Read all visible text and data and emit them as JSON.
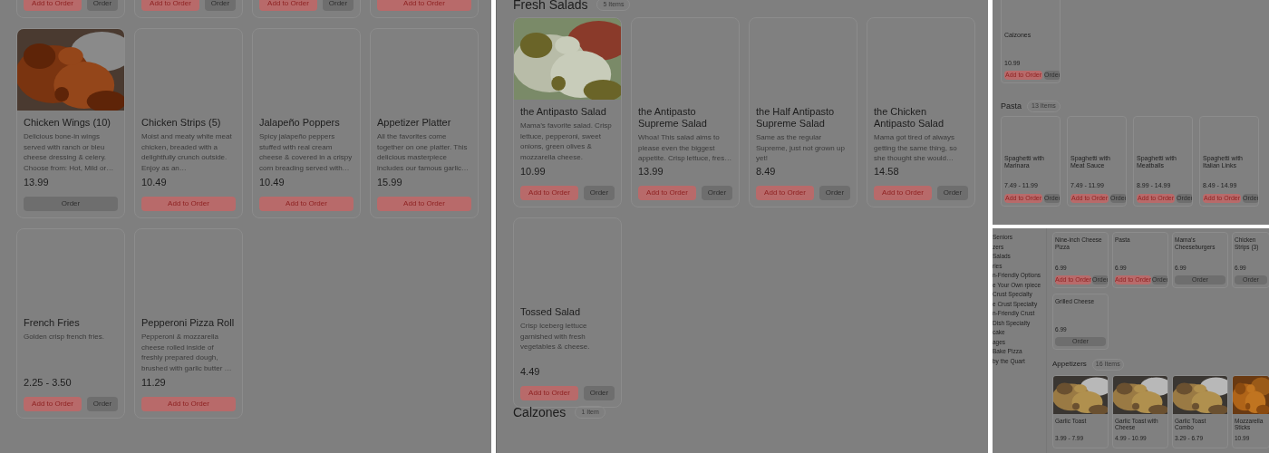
{
  "panels": [
    {
      "kind": "full",
      "sections": [
        {
          "cards": [
            {
              "buttons": [
                {
                  "label": "Add to Order",
                  "kind": "add"
                },
                {
                  "label": "Order",
                  "kind": "order"
                }
              ]
            },
            {
              "buttons": [
                {
                  "label": "Add to Order",
                  "kind": "add"
                },
                {
                  "label": "Order",
                  "kind": "order"
                }
              ]
            },
            {
              "buttons": [
                {
                  "label": "Add to Order",
                  "kind": "add"
                },
                {
                  "label": "Order",
                  "kind": "order"
                }
              ]
            },
            {
              "buttons": [
                {
                  "label": "Add to Order",
                  "kind": "add"
                }
              ]
            },
            {
              "photo": true,
              "name": "Chicken Wings (10)",
              "description": "Delicious bone-in wings served with ranch or bleu cheese dressing & celery. Choose from: Hot, Mild or…",
              "price": "13.99",
              "buttons": [
                {
                  "label": "Order",
                  "kind": "order"
                }
              ]
            },
            {
              "photo": false,
              "name": "Chicken Strips (5)",
              "description": "Moist and meaty white meat chicken, breaded with a delightfully crunch outside. Enjoy as an…",
              "price": "10.49",
              "buttons": [
                {
                  "label": "Add to Order",
                  "kind": "add"
                }
              ]
            },
            {
              "photo": false,
              "name": "Jalapeño Poppers",
              "description": "Spicy jalapeño peppers stuffed with real cream cheese & covered in a crispy corn breading served with…",
              "price": "10.49",
              "buttons": [
                {
                  "label": "Add to Order",
                  "kind": "add"
                }
              ]
            },
            {
              "photo": false,
              "name": "Appetizer Platter",
              "description": "All the favorites come together on one platter. This delicious masterpiece includes our famous garlic…",
              "price": "15.99",
              "buttons": [
                {
                  "label": "Add to Order",
                  "kind": "add"
                }
              ]
            },
            {
              "photo": false,
              "name": "French Fries",
              "description": "Golden crisp french fries.",
              "price": "2.25 - 3.50",
              "buttons": [
                {
                  "label": "Add to Order",
                  "kind": "add"
                },
                {
                  "label": "Order",
                  "kind": "order"
                }
              ]
            },
            {
              "photo": false,
              "name": "Pepperoni Pizza Roll",
              "description": "Pepperoni & mozzarella cheese rolled inside of freshly prepared dough, brushed with garlic butter …",
              "price": "11.29",
              "buttons": [
                {
                  "label": "Add to Order",
                  "kind": "add"
                }
              ]
            }
          ]
        }
      ]
    },
    {
      "kind": "full",
      "sections": [
        {
          "title": "Fresh Salads",
          "count": "5 Items",
          "cards": [
            {
              "photo": true,
              "name": "the Antipasto Salad",
              "description": "Mama’s favorite salad. Crisp lettuce, pepperoni, sweet onions, green olives & mozzarella cheese.",
              "price": "10.99",
              "buttons": [
                {
                  "label": "Add to Order",
                  "kind": "add"
                },
                {
                  "label": "Order",
                  "kind": "order"
                }
              ]
            },
            {
              "photo": false,
              "name": "the Antipasto Supreme Salad",
              "description": "Whoa! This salad aims to please even the biggest appetite. Crisp lettuce, fres…",
              "price": "13.99",
              "buttons": [
                {
                  "label": "Add to Order",
                  "kind": "add"
                },
                {
                  "label": "Order",
                  "kind": "order"
                }
              ]
            },
            {
              "photo": false,
              "name": "the Half Antipasto Supreme Salad",
              "description": "Same as the regular Supreme, just not grown up yet!",
              "price": "8.49",
              "buttons": [
                {
                  "label": "Add to Order",
                  "kind": "add"
                },
                {
                  "label": "Order",
                  "kind": "order"
                }
              ]
            },
            {
              "photo": false,
              "name": "the Chicken Antipasto Salad",
              "description": "Mama got tired of always getting the same thing, so she thought she would…",
              "price": "14.58",
              "buttons": [
                {
                  "label": "Add to Order",
                  "kind": "add"
                },
                {
                  "label": "Order",
                  "kind": "order"
                }
              ]
            },
            {
              "photo": false,
              "name": "Tossed Salad",
              "description": "Crisp Iceberg lettuce garnished with fresh vegetables & cheese.",
              "price": "4.49",
              "buttons": [
                {
                  "label": "Add to Order",
                  "kind": "add"
                },
                {
                  "label": "Order",
                  "kind": "order"
                }
              ]
            }
          ]
        },
        {
          "title": "Calzones",
          "count": "1 Item"
        }
      ]
    },
    {
      "kind": "compact",
      "sections": [
        {
          "cards": [
            {
              "photo": false,
              "name": "Calzones",
              "price": "10.99",
              "buttons": [
                {
                  "label": "Add to Order",
                  "kind": "add"
                },
                {
                  "label": "Order",
                  "kind": "order"
                }
              ]
            }
          ]
        },
        {
          "title": "Pasta",
          "count": "13 Items",
          "cards": [
            {
              "photo": false,
              "name": "Spaghetti with Marinara",
              "price": "7.49 - 11.99",
              "buttons": [
                {
                  "label": "Add to Order",
                  "kind": "add"
                },
                {
                  "label": "Order",
                  "kind": "order"
                }
              ]
            },
            {
              "photo": false,
              "name": "Spaghetti with Meat Sauce",
              "price": "7.49 - 11.99",
              "buttons": [
                {
                  "label": "Add to Order",
                  "kind": "add"
                },
                {
                  "label": "Order",
                  "kind": "order"
                }
              ]
            },
            {
              "photo": false,
              "name": "Spaghetti with Meatballs",
              "price": "8.99 - 14.99",
              "buttons": [
                {
                  "label": "Add to Order",
                  "kind": "add"
                },
                {
                  "label": "Order",
                  "kind": "order"
                }
              ]
            },
            {
              "photo": false,
              "name": "Spaghetti with Italian Links",
              "price": "8.49 - 14.99",
              "buttons": [
                {
                  "label": "Add to Order",
                  "kind": "add"
                },
                {
                  "label": "Order",
                  "kind": "order"
                }
              ]
            }
          ]
        }
      ]
    },
    {
      "kind": "compact_nav",
      "sidebar": [
        "Seniors",
        "zers",
        "Salads",
        "ries",
        "n-Friendly Options",
        "e Your Own rpiece",
        "Crust Specialty",
        "e Crust Specialty",
        "n-Friendly Crust",
        "Dish Specialty",
        "cake",
        "ages",
        "Bake Pizza",
        "by the Quart"
      ],
      "sections": [
        {
          "cards": [
            {
              "name": "Nine-inch Cheese Pizza",
              "price": "6.99",
              "buttons": [
                {
                  "label": "Add to Order",
                  "kind": "add"
                },
                {
                  "label": "Order",
                  "kind": "order"
                }
              ]
            },
            {
              "name": "Pasta",
              "price": "6.99",
              "buttons": [
                {
                  "label": "Add to Order",
                  "kind": "add"
                },
                {
                  "label": "Order",
                  "kind": "order"
                }
              ]
            },
            {
              "name": "Mama’s Cheeseburgers",
              "price": "6.99",
              "buttons": [
                {
                  "label": "Order",
                  "kind": "order"
                }
              ]
            },
            {
              "name": "Chicken Strips (3)",
              "price": "6.99",
              "buttons": [
                {
                  "label": "Order",
                  "kind": "order"
                }
              ]
            },
            {
              "name": "Grilled Cheese",
              "price": "6.99",
              "buttons": [
                {
                  "label": "Order",
                  "kind": "order"
                }
              ]
            }
          ]
        },
        {
          "title": "Appetizers",
          "count": "16 Items",
          "cards": [
            {
              "photo": true,
              "name": "Garlic Toast",
              "price": "3.99 - 7.99"
            },
            {
              "photo": true,
              "name": "Garlic Toast with Cheese",
              "price": "4.99 - 10.99"
            },
            {
              "photo": true,
              "name": "Garlic Toast Combo",
              "price": "3.29 - 6.79"
            },
            {
              "photo": true,
              "name": "Mozzarella Sticks",
              "price": "10.99"
            }
          ]
        }
      ]
    }
  ]
}
